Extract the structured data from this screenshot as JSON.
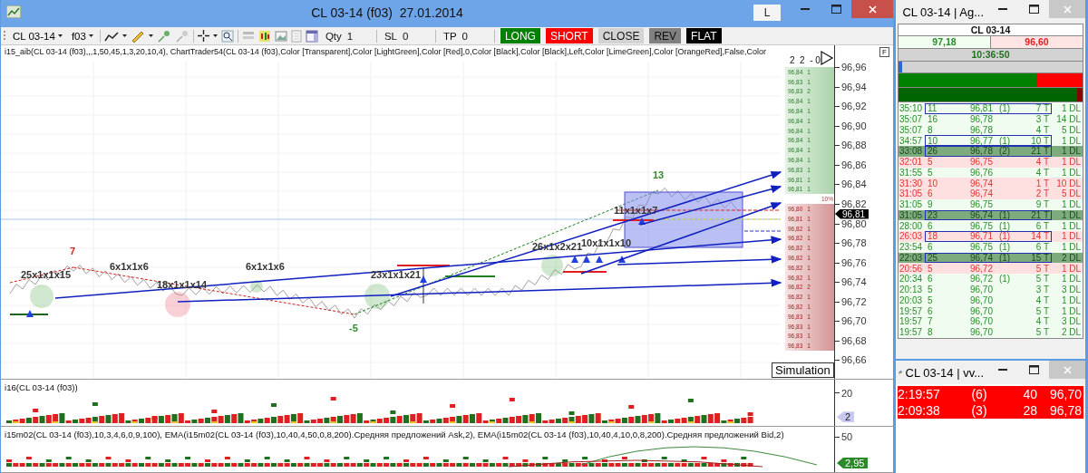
{
  "window": {
    "title": "CL 03-14 (f03)  27.01.2014",
    "mode_button": "L"
  },
  "toolbar": {
    "instrument": "CL 03-14",
    "account": "f03",
    "fields": [
      {
        "label": "Qty",
        "value": "1"
      },
      {
        "label": "SL",
        "value": "0"
      },
      {
        "label": "TP",
        "value": "0"
      }
    ],
    "orders": [
      {
        "label": "LONG",
        "color": "#008000"
      },
      {
        "label": "SHORT",
        "color": "#ff0000"
      },
      {
        "label": "CLOSE",
        "color": "#d3d3d3"
      },
      {
        "label": "REV",
        "color": "#808080"
      },
      {
        "label": "FLAT",
        "color": "#000000"
      }
    ]
  },
  "chart": {
    "indicators": "i15_aib(CL 03-14 (f03),,,1,50,45,1,3,20,10,4), ChartTrader54(CL 03-14 (f03),Color [Transparent],Color [LightGreen],Color [Red],0,Color [Black],Color [Black],Left,Color [LimeGreen],Color [OrangeRed],False,Color",
    "flag_button": "F",
    "ladder_header": "2  2  - 0",
    "ladder_mark": "10%",
    "ladder_ask": [
      {
        "price": "96,84",
        "size": "1"
      },
      {
        "price": "96,83",
        "size": "1"
      },
      {
        "price": "96,83",
        "size": "2"
      },
      {
        "price": "96,84",
        "size": "1"
      },
      {
        "price": "96,84",
        "size": "1"
      },
      {
        "price": "96,84",
        "size": "1"
      },
      {
        "price": "96,84",
        "size": "1"
      },
      {
        "price": "96,84",
        "size": "1"
      },
      {
        "price": "96,84",
        "size": "1"
      },
      {
        "price": "96,84",
        "size": "1"
      },
      {
        "price": "96,83",
        "size": "1"
      },
      {
        "price": "96,81",
        "size": "1"
      },
      {
        "price": "96,81",
        "size": "1"
      }
    ],
    "ladder_bid": [
      {
        "price": "96,80",
        "size": "1"
      },
      {
        "price": "96,81",
        "size": "1"
      },
      {
        "price": "96,82",
        "size": "1"
      },
      {
        "price": "96,82",
        "size": "1"
      },
      {
        "price": "96,82",
        "size": "1"
      },
      {
        "price": "96,82",
        "size": "1"
      },
      {
        "price": "96,82",
        "size": "1"
      },
      {
        "price": "96,82",
        "size": "1"
      },
      {
        "price": "96,82",
        "size": "2"
      },
      {
        "price": "96,82",
        "size": "1"
      },
      {
        "price": "96,82",
        "size": "1"
      },
      {
        "price": "96,83",
        "size": "1"
      },
      {
        "price": "96,83",
        "size": "1"
      },
      {
        "price": "96,83",
        "size": "1"
      },
      {
        "price": "96,83",
        "size": "1"
      }
    ],
    "price_axis": [
      "96,96",
      "96,94",
      "96,92",
      "96,90",
      "96,88",
      "96,86",
      "96,84",
      "96,82",
      "96,80",
      "96,78",
      "96,76",
      "96,74",
      "96,72",
      "96,70",
      "96,68",
      "96,66"
    ],
    "last_price": "96,81",
    "labels": [
      {
        "text": "25x1x1x15",
        "color": "#333333"
      },
      {
        "text": "7",
        "color": "#e02020"
      },
      {
        "text": "6x1x1x6",
        "color": "#333333"
      },
      {
        "text": "18x1x1x14",
        "color": "#333333"
      },
      {
        "text": "6x1x1x6",
        "color": "#333333"
      },
      {
        "text": "-5",
        "color": "#2e8b2e"
      },
      {
        "text": "23x1x1x21",
        "color": "#333333"
      },
      {
        "text": "26x1x2x21",
        "color": "#333333"
      },
      {
        "text": "10x1x1x10",
        "color": "#333333"
      },
      {
        "text": "11x1x1x7",
        "color": "#333333"
      },
      {
        "text": "13",
        "color": "#2e8b2e"
      }
    ],
    "status": "Simulation"
  },
  "panels": [
    {
      "title": "i16(CL 03-14 (f03))",
      "axis_tick": "20",
      "tag": "2",
      "kind": "volume"
    },
    {
      "title": "i15m02(CL 03-14 (f03),10,3,4,6,0,9,100), EMA(i15m02(CL 03-14 (f03),10,40,4,50,0,8,200).Средняя предложений Ask,2), EMA(i15m02(CL 03-14 (f03),10,40,4,10,0,8,200).Средняя предложений Bid,2)",
      "axis_tick": "50",
      "tag": "2,95",
      "kind": "oscillator"
    }
  ],
  "tape": {
    "title": "CL 03-14 | Ag...",
    "symbol": "CL 03-14",
    "ask": "97,18",
    "bid": "96,60",
    "time": "10:36:50",
    "progress": {
      "level": 0.02
    },
    "balance": {
      "level": 0.75
    },
    "volume_balance": {
      "level": 0.97
    },
    "rows": [
      {
        "time": "35:10",
        "size": "11",
        "price": "96,81",
        "count": "(1)",
        "ticks": "7 T",
        "dl": "1 DL",
        "sell": false,
        "large": false,
        "boxed": true
      },
      {
        "time": "35:07",
        "size": "16",
        "price": "96,78",
        "ticks": "3 T",
        "dl": "14 DL",
        "sell": false,
        "large": false,
        "boxed": false
      },
      {
        "time": "35:07",
        "size": "8",
        "price": "96,78",
        "ticks": "4 T",
        "dl": "5 DL",
        "sell": false,
        "large": false,
        "boxed": false
      },
      {
        "time": "34:57",
        "size": "10",
        "price": "96,77",
        "count": "(1)",
        "ticks": "10 T",
        "dl": "1 DL",
        "sell": false,
        "large": false,
        "boxed": true
      },
      {
        "time": "33:08",
        "size": "26",
        "price": "96,78",
        "count": "(2)",
        "ticks": "21 T",
        "dl": "1 DL",
        "sell": false,
        "large": true,
        "boxed": true
      },
      {
        "time": "32:01",
        "size": "5",
        "price": "96,75",
        "ticks": "4 T",
        "dl": "1 DL",
        "sell": true,
        "large": false,
        "boxed": false
      },
      {
        "time": "31:55",
        "size": "5",
        "price": "96,76",
        "ticks": "4 T",
        "dl": "1 DL",
        "sell": false,
        "large": false,
        "boxed": false
      },
      {
        "time": "31:30",
        "size": "10",
        "price": "96,74",
        "ticks": "1 T",
        "dl": "10 DL",
        "sell": true,
        "large": false,
        "boxed": false
      },
      {
        "time": "31:05",
        "size": "6",
        "price": "96,74",
        "ticks": "2 T",
        "dl": "5 DL",
        "sell": true,
        "large": false,
        "boxed": false
      },
      {
        "time": "31:05",
        "size": "9",
        "price": "96,75",
        "ticks": "9 T",
        "dl": "1 DL",
        "sell": false,
        "large": false,
        "boxed": false
      },
      {
        "time": "31:05",
        "size": "23",
        "price": "96,74",
        "count": "(1)",
        "ticks": "21 T",
        "dl": "1 DL",
        "sell": false,
        "large": true,
        "boxed": true
      },
      {
        "time": "28:00",
        "size": "6",
        "price": "96,75",
        "count": "(1)",
        "ticks": "6 T",
        "dl": "1 DL",
        "sell": false,
        "large": false,
        "boxed": false
      },
      {
        "time": "26:03",
        "size": "18",
        "price": "96,71",
        "count": "(1)",
        "ticks": "14 T",
        "dl": "1 DL",
        "sell": true,
        "large": false,
        "boxed": true
      },
      {
        "time": "23:54",
        "size": "6",
        "price": "96,75",
        "count": "(1)",
        "ticks": "6 T",
        "dl": "1 DL",
        "sell": false,
        "large": false,
        "boxed": false
      },
      {
        "time": "22:03",
        "size": "25",
        "price": "96,74",
        "count": "(1)",
        "ticks": "15 T",
        "dl": "2 DL",
        "sell": false,
        "large": true,
        "boxed": true
      },
      {
        "time": "20:56",
        "size": "5",
        "price": "96,72",
        "ticks": "5 T",
        "dl": "1 DL",
        "sell": true,
        "large": false,
        "boxed": false
      },
      {
        "time": "20:34",
        "size": "6",
        "price": "96,72",
        "count": "(1)",
        "ticks": "5 T",
        "dl": "1 DL",
        "sell": false,
        "large": false,
        "boxed": false
      },
      {
        "time": "20:13",
        "size": "5",
        "price": "96,70",
        "ticks": "3 T",
        "dl": "3 DL",
        "sell": false,
        "large": false,
        "boxed": false
      },
      {
        "time": "20:03",
        "size": "5",
        "price": "96,70",
        "ticks": "4 T",
        "dl": "1 DL",
        "sell": false,
        "large": false,
        "boxed": false
      },
      {
        "time": "19:57",
        "size": "6",
        "price": "96,70",
        "ticks": "5 T",
        "dl": "1 DL",
        "sell": false,
        "large": false,
        "boxed": false
      },
      {
        "time": "19:57",
        "size": "7",
        "price": "96,70",
        "ticks": "4 T",
        "dl": "3 DL",
        "sell": false,
        "large": false,
        "boxed": false
      },
      {
        "time": "19:57",
        "size": "8",
        "price": "96,70",
        "ticks": "5 T",
        "dl": "2 DL",
        "sell": false,
        "large": false,
        "boxed": false
      }
    ]
  },
  "alerts": {
    "title": "CL 03-14 | vv...",
    "rows": [
      {
        "time": "2:19:57",
        "count": "(6)",
        "size": "40",
        "price": "96,70"
      },
      {
        "time": "2:09:38",
        "count": "(3)",
        "size": "28",
        "price": "96,78"
      }
    ]
  }
}
